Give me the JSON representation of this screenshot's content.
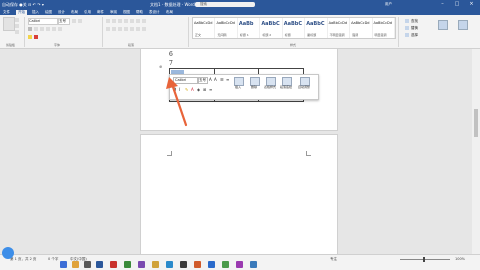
{
  "titlebar": {
    "left_text": "自动保存 ●关  ⊟  ↶  ↷  ▾",
    "title": "文档1 - 数据处理 - Word",
    "search_placeholder": "搜索",
    "user": "用户",
    "colors": {
      "bar": "#2b579a"
    }
  },
  "tabs": [
    "文件",
    "开始",
    "插入",
    "绘图",
    "设计",
    "布局",
    "引用",
    "邮件",
    "审阅",
    "视图",
    "帮助",
    "表设计",
    "布局"
  ],
  "tabs_active": "开始",
  "ribbon": {
    "clipboard_label": "剪贴板",
    "font_label": "字体",
    "paragraph_label": "段落",
    "styles_label": "样式",
    "font_name": "Calibri",
    "font_size": "五号",
    "styles": [
      {
        "preview": "AaBbCcDd",
        "name": "正文",
        "big": false
      },
      {
        "preview": "AaBbCcDd",
        "name": "无间隔",
        "big": false
      },
      {
        "preview": "AaBb",
        "name": "标题 1",
        "big": true
      },
      {
        "preview": "AaBbC",
        "name": "标题 2",
        "big": true
      },
      {
        "preview": "AaBbC",
        "name": "标题",
        "big": true
      },
      {
        "preview": "AaBbC",
        "name": "副标题",
        "big": true
      },
      {
        "preview": "AaBbCcDd",
        "name": "不明显强调",
        "big": false
      },
      {
        "preview": "AaBbCcDd",
        "name": "强调",
        "big": false
      },
      {
        "preview": "AaBbCcDd",
        "name": "明显强调",
        "big": false
      }
    ],
    "right_buttons": [
      "查找",
      "替换",
      "选择"
    ]
  },
  "document": {
    "lines": [
      "6",
      "7"
    ],
    "mini_toolbar": {
      "font": "Calibri",
      "size": "五号",
      "buttons": [
        "插入",
        "删除",
        "表格样式",
        "段落底纹",
        "自动调整"
      ]
    }
  },
  "status": {
    "page": "第 1 页，共 2 页",
    "words": "0 个字",
    "lang": "中文(中国)",
    "focus": "专注",
    "zoom": "100%"
  }
}
